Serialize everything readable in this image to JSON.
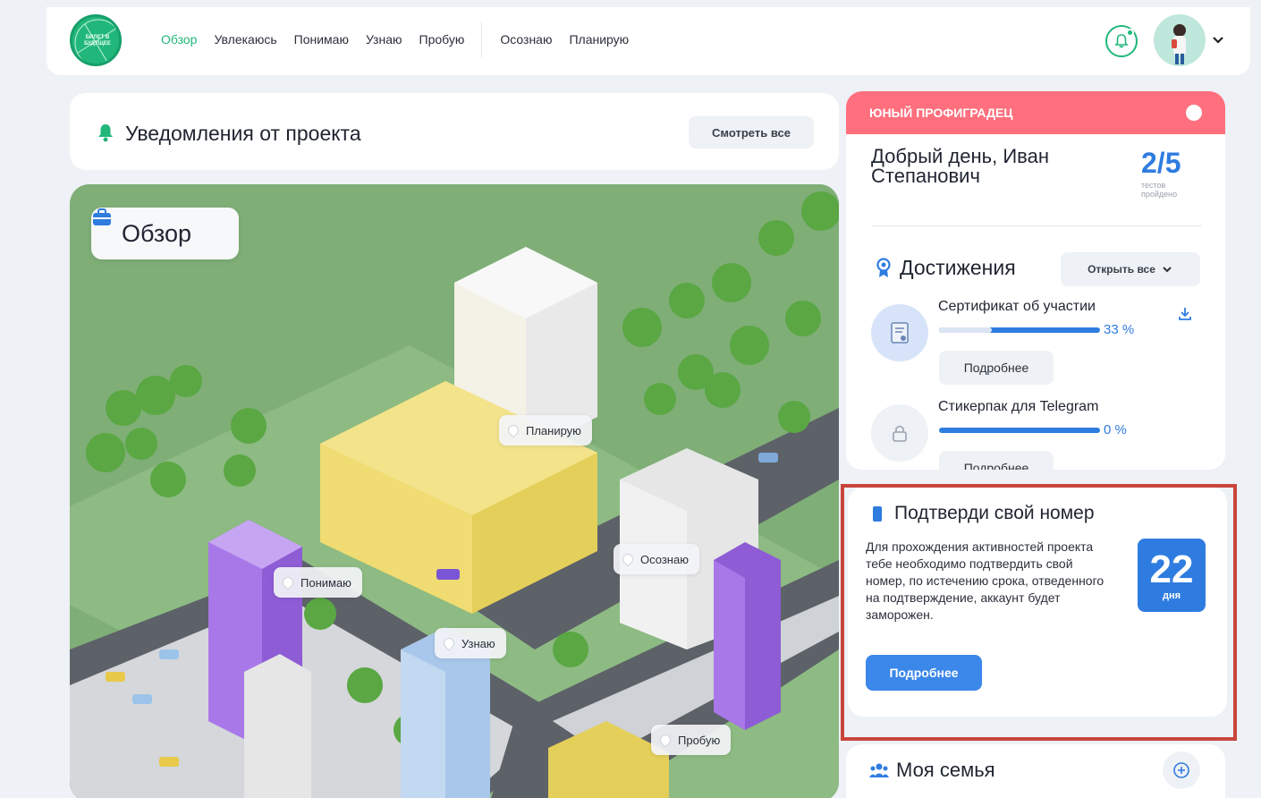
{
  "header": {
    "logo_text": "БИЛЕТ В БУДУЩЕЕ",
    "nav": [
      "Обзор",
      "Увлекаюсь",
      "Понимаю",
      "Узнаю",
      "Пробую",
      "Осознаю",
      "Планирую"
    ],
    "icons": [
      "notifications-bell-icon",
      "user-avatar",
      "chevron-down-icon"
    ]
  },
  "notifications": {
    "title": "Уведомления от проекта",
    "see_all": "Смотреть все"
  },
  "map": {
    "badge": "Обзор",
    "pins": [
      "Планирую",
      "Понимаю",
      "Осознаю",
      "Узнаю",
      "Пробую"
    ]
  },
  "profile": {
    "role": "ЮНЫЙ ПРОФИГРАДЕЦ",
    "greeting": "Добрый день, Иван Степанович",
    "tests_done": "2/5",
    "tests_label": "тестов пройдено"
  },
  "achievements": {
    "title": "Достижения",
    "open_all": "Открыть все",
    "items": [
      {
        "name": "Сертификат об участии",
        "progress": "33 %",
        "more": "Подробнее"
      },
      {
        "name": "Стикерпак для Telegram",
        "progress": "0 %",
        "more": "Подробнее"
      }
    ]
  },
  "verify": {
    "title": "Подтверди свой номер",
    "text": "Для прохождения активностей проекта тебе необходимо подтвердить свой номер, по истечению срока, отведенного на подтверждение, аккаунт будет заморожен.",
    "days": "22",
    "days_label": "дня",
    "button": "Подробнее"
  },
  "family": {
    "title": "Моя семья"
  },
  "colors": {
    "brand_green": "#22b77a",
    "accent_blue": "#2f7ce0",
    "alert_red": "#ff6f7d",
    "highlight_frame": "#c9453c"
  }
}
